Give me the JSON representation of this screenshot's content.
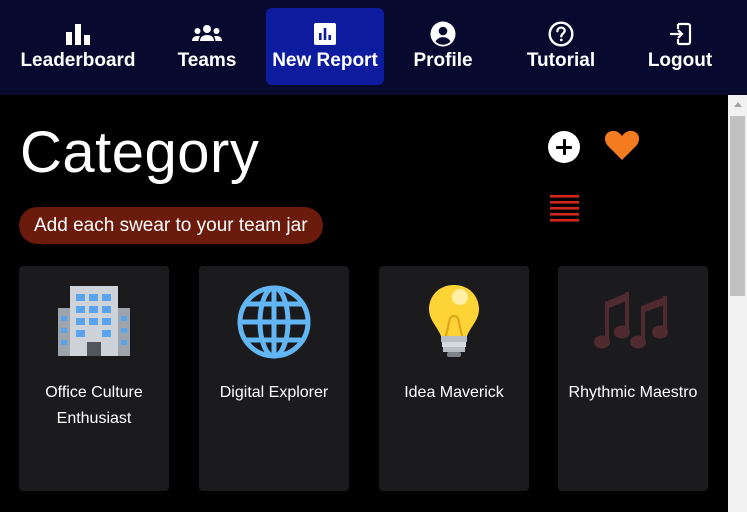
{
  "nav": {
    "items": [
      {
        "label": "Leaderboard",
        "icon": "bar-chart-icon",
        "active": false
      },
      {
        "label": "Teams",
        "icon": "people-icon",
        "active": false
      },
      {
        "label": "New Report",
        "icon": "report-icon",
        "active": true
      },
      {
        "label": "Profile",
        "icon": "account-circle-icon",
        "active": false
      },
      {
        "label": "Tutorial",
        "icon": "help-circle-icon",
        "active": false
      },
      {
        "label": "Logout",
        "icon": "logout-icon",
        "active": false
      }
    ]
  },
  "main": {
    "title": "Category",
    "hint": "Add each swear to your team jar",
    "actions": {
      "add": "plus-circle-icon",
      "favorite": "heart-icon",
      "list": "list-icon"
    },
    "cards": [
      {
        "label": "Office Culture Enthusiast",
        "icon": "office-building-icon"
      },
      {
        "label": "Digital Explorer",
        "icon": "globe-icon"
      },
      {
        "label": "Idea Maverick",
        "icon": "light-bulb-icon"
      },
      {
        "label": "Rhythmic Maestro",
        "icon": "music-notes-icon"
      }
    ]
  },
  "colors": {
    "nav_bg": "#070a2e",
    "nav_active": "#0d1b9e",
    "hint_bg": "#6b1b0c",
    "heart": "#f47b20",
    "list_icon": "#d0271d",
    "card_bg": "#1b1b1d"
  }
}
